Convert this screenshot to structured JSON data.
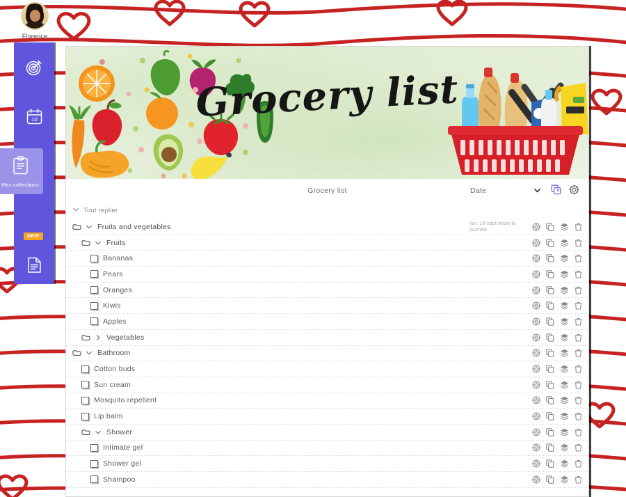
{
  "user": {
    "name": "Florence",
    "avatar_icon": "user-avatar-photo"
  },
  "colors": {
    "rail_purple": "#6055dd",
    "rail_active_purple": "#9b93e8",
    "badge_orange": "#f5a623",
    "wallpaper_red": "#c62222",
    "accent_copy_icon": "#7a6fe0"
  },
  "sidebar": {
    "items": [
      {
        "icon": "target-goal-icon",
        "label": ""
      },
      {
        "icon": "calendar-10-icon",
        "label": ""
      },
      {
        "icon": "open-book-icon",
        "label": ""
      },
      {
        "icon": "clipboard-collections-icon",
        "label": "Mes collections"
      },
      {
        "icon": "document-note-icon",
        "label": "",
        "badge": "NEW"
      }
    ],
    "active_label": "Mes collections",
    "new_badge": "NEW"
  },
  "banner": {
    "title": "Grocery list",
    "left_art": "fruits-and-vegetables-illustration",
    "right_art": "shopping-basket-illustration"
  },
  "toolbar": {
    "list_name": "Grocery list",
    "sort_label": "Date",
    "chevron_icon": "chevron-down-icon",
    "copy_icon": "duplicate-icon",
    "settings_icon": "gear-icon"
  },
  "collapse_all": {
    "label": "Tout replier",
    "icon": "chevron-down-icon"
  },
  "row_actions": {
    "color_icon": "color-palette-icon",
    "duplicate_icon": "duplicate-icon",
    "layers_icon": "layers-icon",
    "delete_icon": "trash-icon"
  },
  "list": {
    "rows": [
      {
        "type": "folder",
        "label": "Fruits and vegetables",
        "level": 0,
        "expanded": true,
        "caret": "chevron-down-icon",
        "date": "lun. 18 sept toute la journée"
      },
      {
        "type": "folder",
        "label": "Fruits",
        "level": 1,
        "expanded": true,
        "caret": "chevron-down-icon",
        "date": ""
      },
      {
        "type": "task",
        "label": "Bananas",
        "level": 2,
        "checked": false,
        "date": ""
      },
      {
        "type": "task",
        "label": "Pears",
        "level": 2,
        "checked": false,
        "date": ""
      },
      {
        "type": "task",
        "label": "Oranges",
        "level": 2,
        "checked": false,
        "date": ""
      },
      {
        "type": "task",
        "label": "Kiwis",
        "level": 2,
        "checked": false,
        "date": ""
      },
      {
        "type": "task",
        "label": "Apples",
        "level": 2,
        "checked": false,
        "date": ""
      },
      {
        "type": "folder",
        "label": "Vegetables",
        "level": 1,
        "expanded": false,
        "caret": "chevron-right-icon",
        "date": ""
      },
      {
        "type": "folder",
        "label": "Bathroom",
        "level": 0,
        "expanded": true,
        "caret": "chevron-down-icon",
        "date": ""
      },
      {
        "type": "task",
        "label": "Cotton buds",
        "level": 1,
        "checked": false,
        "date": ""
      },
      {
        "type": "task",
        "label": "Sun cream",
        "level": 1,
        "checked": false,
        "date": ""
      },
      {
        "type": "task",
        "label": "Mosquito repellent",
        "level": 1,
        "checked": false,
        "date": ""
      },
      {
        "type": "task",
        "label": "Lip balm",
        "level": 1,
        "checked": false,
        "date": ""
      },
      {
        "type": "folder",
        "label": "Shower",
        "level": 1,
        "expanded": true,
        "caret": "chevron-down-icon",
        "date": ""
      },
      {
        "type": "task",
        "label": "Intimate gel",
        "level": 2,
        "checked": false,
        "date": ""
      },
      {
        "type": "task",
        "label": "Shower gel",
        "level": 2,
        "checked": false,
        "date": ""
      },
      {
        "type": "task",
        "label": "Shampoo",
        "level": 2,
        "checked": false,
        "date": ""
      }
    ]
  }
}
